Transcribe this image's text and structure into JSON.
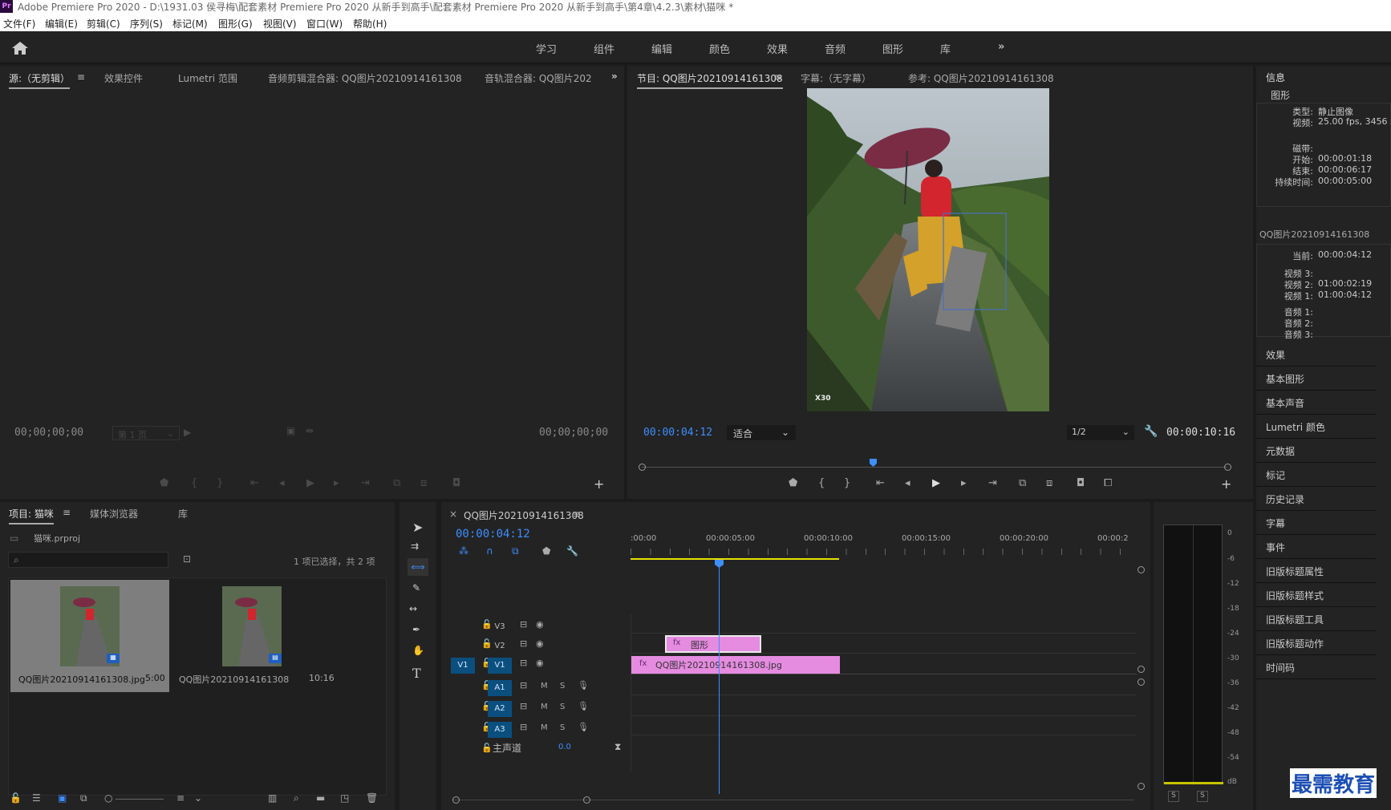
{
  "title_bar": {
    "app_icon": "Pr",
    "title": "Adobe Premiere Pro 2020 - D:\\1931.03 侯寻梅\\配套素材 Premiere Pro 2020 从新手到高手\\配套素材 Premiere Pro 2020 从新手到高手\\第4章\\4.2.3\\素材\\猫咪 *"
  },
  "menu": [
    "文件(F)",
    "编辑(E)",
    "剪辑(C)",
    "序列(S)",
    "标记(M)",
    "图形(G)",
    "视图(V)",
    "窗口(W)",
    "帮助(H)"
  ],
  "workspaces": [
    "学习",
    "组件",
    "编辑",
    "颜色",
    "效果",
    "音频",
    "图形",
    "库"
  ],
  "source_panel": {
    "tabs": [
      "源:（无剪辑）",
      "效果控件",
      "Lumetri 范围",
      "音频剪辑混合器: QQ图片20210914161308",
      "音轨混合器: QQ图片202"
    ],
    "timecode_left": "00;00;00;00",
    "page_select": "第 1 页",
    "timecode_right": "00;00;00;00"
  },
  "program_panel": {
    "tabs": [
      "节目: QQ图片20210914161308",
      "字幕:（无字幕）",
      "参考: QQ图片20210914161308"
    ],
    "timecode": "00:00:04:12",
    "fit": "适合",
    "resolution": "1/2",
    "duration": "00:00:10:16",
    "watermark": "X30"
  },
  "info_panel": {
    "header": "信息",
    "section": "图形",
    "rows": [
      {
        "k": "类型:",
        "v": "静止图像"
      },
      {
        "k": "视频:",
        "v": "25.00 fps, 3456 x"
      },
      {
        "k": "磁带:",
        "v": ""
      },
      {
        "k": "开始:",
        "v": "00:00:01:18"
      },
      {
        "k": "结束:",
        "v": "00:00:06:17"
      },
      {
        "k": "持续时间:",
        "v": "00:00:05:00"
      }
    ],
    "clip_name": "QQ图片20210914161308",
    "rows2": [
      {
        "k": "当前:",
        "v": "00:00:04:12"
      },
      {
        "k": "视频 3:",
        "v": ""
      },
      {
        "k": "视频 2:",
        "v": "01:00:02:19"
      },
      {
        "k": "视频 1:",
        "v": "01:00:04:12"
      },
      {
        "k": "音频 1:",
        "v": ""
      },
      {
        "k": "音频 2:",
        "v": ""
      },
      {
        "k": "音频 3:",
        "v": ""
      }
    ],
    "list": [
      "效果",
      "基本图形",
      "基本声音",
      "Lumetri 颜色",
      "元数据",
      "标记",
      "历史记录",
      "字幕",
      "事件",
      "旧版标题属性",
      "旧版标题样式",
      "旧版标题工具",
      "旧版标题动作",
      "时间码"
    ]
  },
  "project_panel": {
    "tabs": [
      "项目: 猫咪",
      "媒体浏览器",
      "库"
    ],
    "file": "猫咪.prproj",
    "selection": "1 项已选择，共 2 项",
    "items": [
      {
        "name": "QQ图片20210914161308.jpg",
        "dur": "5:00"
      },
      {
        "name": "QQ图片20210914161308",
        "dur": "10:16"
      }
    ]
  },
  "timeline": {
    "tab": "QQ图片20210914161308",
    "timecode": "00:00:04:12",
    "ruler": [
      ":00:00",
      "00:00:05:00",
      "00:00:10:00",
      "00:00:15:00",
      "00:00:20:00",
      "00:00:2"
    ],
    "video_tracks": [
      "V3",
      "V2",
      "V1"
    ],
    "audio_tracks": [
      "A1",
      "A2",
      "A3"
    ],
    "source_patch": "V1",
    "master": {
      "label": "主声道",
      "value": "0.0"
    },
    "clip_graphic": "图形",
    "clip_image": "QQ图片20210914161308.jpg",
    "btn_m": "M",
    "btn_s": "S"
  },
  "meter": {
    "scale": [
      "0",
      "-6",
      "-12",
      "-18",
      "-24",
      "-30",
      "-36",
      "-42",
      "-48",
      "-54",
      "dB"
    ],
    "solo": [
      "S",
      "S"
    ]
  },
  "corner_logo": "最需教育",
  "colors": {
    "accent_blue": "#3d8eff",
    "clip_pink": "#e58be0",
    "track_on": "#0b4f7f",
    "timeline_yellow": "#e5e000"
  }
}
